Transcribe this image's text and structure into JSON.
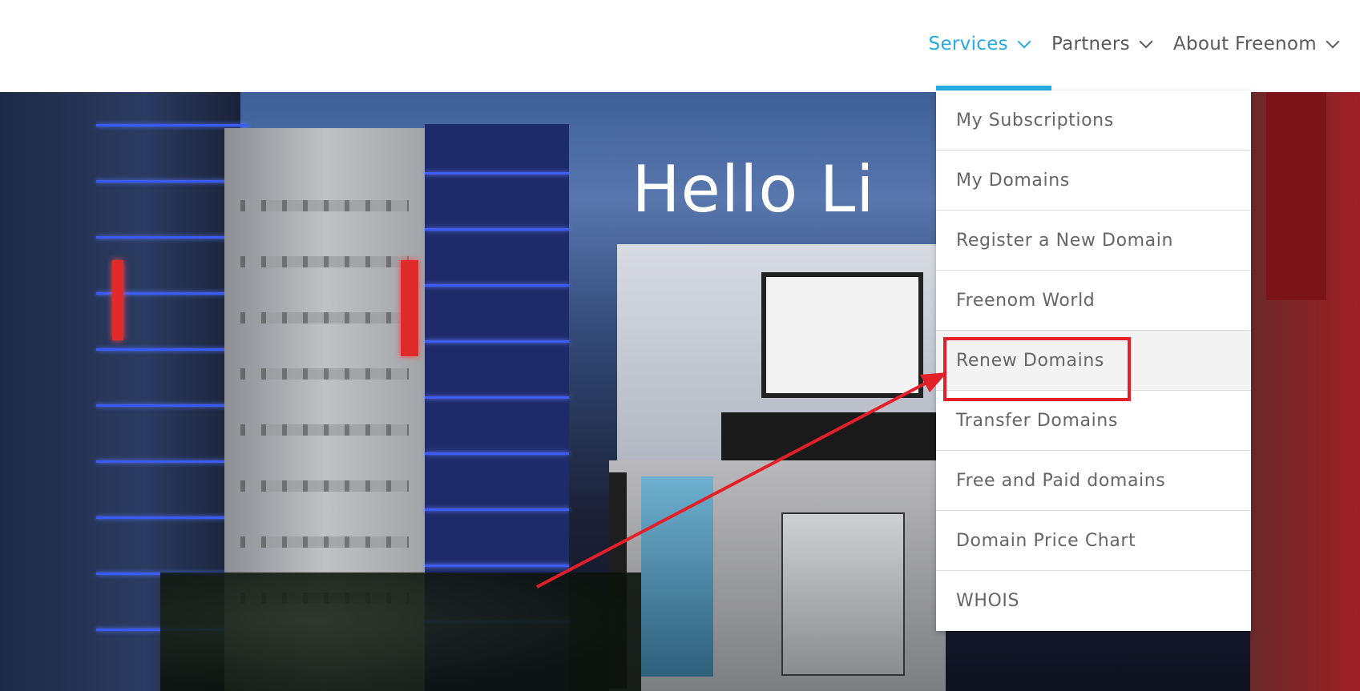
{
  "nav": {
    "items": [
      {
        "label": "Services",
        "active": true
      },
      {
        "label": "Partners",
        "active": false
      },
      {
        "label": "About Freenom",
        "active": false
      }
    ]
  },
  "hero": {
    "greeting": "Hello Li"
  },
  "services_menu": {
    "items": [
      "My Subscriptions",
      "My Domains",
      "Register a New Domain",
      "Freenom World",
      "Renew Domains",
      "Transfer Domains",
      "Free and Paid domains",
      "Domain Price Chart",
      "WHOIS"
    ],
    "highlighted": "Renew Domains"
  },
  "colors": {
    "accent": "#27a9e1",
    "annotation": "#e3202a"
  }
}
